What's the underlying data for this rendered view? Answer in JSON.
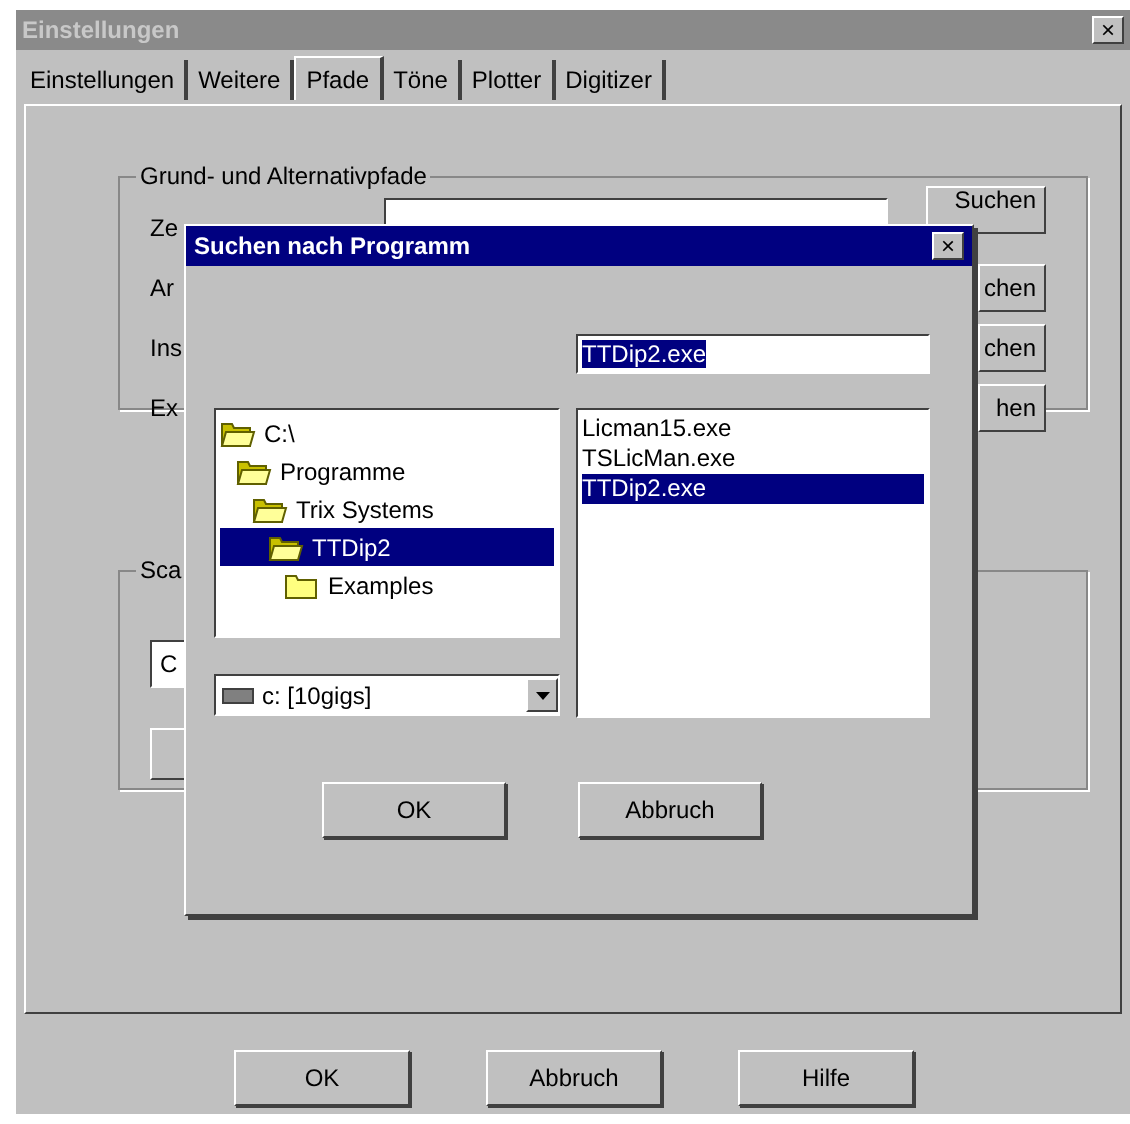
{
  "window": {
    "title": "Einstellungen",
    "close": "×"
  },
  "tabs": [
    {
      "label": "Einstellungen",
      "selected": false
    },
    {
      "label": "Weitere",
      "selected": false
    },
    {
      "label": "Pfade",
      "selected": true
    },
    {
      "label": "Töne",
      "selected": false
    },
    {
      "label": "Plotter",
      "selected": false
    },
    {
      "label": "Digitizer",
      "selected": false
    }
  ],
  "paths_group": {
    "title": "Grund- und Alternativpfade",
    "rows": [
      {
        "label": "Ze",
        "button": "Suchen"
      },
      {
        "label": "Ar",
        "button": "chen"
      },
      {
        "label": "Ins",
        "button": "chen"
      },
      {
        "label": "Ex",
        "button": "hen"
      }
    ]
  },
  "scan_group": {
    "title": "Sca",
    "field": "C"
  },
  "buttons": [
    "OK",
    "Abbruch",
    "Hilfe"
  ],
  "dialog": {
    "title": "Suchen nach Programm",
    "close": "×",
    "filename": "TTDip2.exe",
    "tree": [
      {
        "label": "C:\\",
        "expanded": true,
        "selected": false,
        "children": [
          {
            "label": "Programme",
            "expanded": true,
            "selected": false,
            "children": [
              {
                "label": "Trix Systems",
                "expanded": true,
                "selected": false,
                "children": [
                  {
                    "label": "TTDip2",
                    "expanded": true,
                    "selected": true,
                    "children": [
                      {
                        "label": "Examples",
                        "expanded": false,
                        "selected": false
                      }
                    ]
                  }
                ]
              }
            ]
          }
        ]
      }
    ],
    "files": [
      {
        "label": "Licman15.exe",
        "selected": false
      },
      {
        "label": "TSLicMan.exe",
        "selected": false
      },
      {
        "label": "TTDip2.exe",
        "selected": true
      }
    ],
    "drive": "c: [10gigs]",
    "buttons": [
      "OK",
      "Abbruch"
    ]
  }
}
